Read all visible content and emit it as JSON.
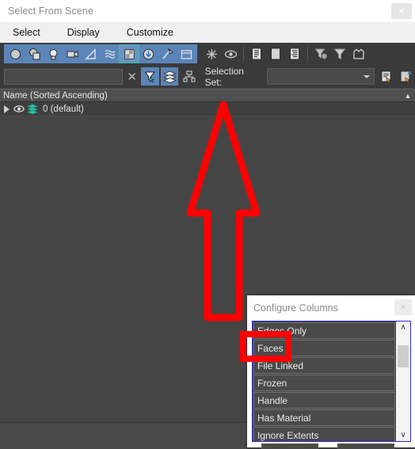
{
  "window": {
    "title": "Select From Scene",
    "close_label": "✕"
  },
  "menubar": {
    "items": [
      {
        "label": "Select"
      },
      {
        "label": "Display"
      },
      {
        "label": "Customize"
      }
    ]
  },
  "toolbar": {
    "filter_group": [
      {
        "icon": "geometry-sphere-icon",
        "selected": false
      },
      {
        "icon": "shapes-icon",
        "selected": false
      },
      {
        "icon": "lights-icon",
        "selected": false
      },
      {
        "icon": "cameras-icon",
        "selected": false
      },
      {
        "icon": "helpers-icon",
        "selected": false
      },
      {
        "icon": "space-warps-icon",
        "selected": false
      },
      {
        "icon": "groups-xrefs-icon",
        "selected": true
      },
      {
        "icon": "external-references-icon",
        "selected": false
      },
      {
        "icon": "bone-objects-icon",
        "selected": false
      },
      {
        "icon": "containers-icon",
        "selected": false
      }
    ],
    "plain_group": [
      {
        "icon": "freeze-snowflake-icon"
      },
      {
        "icon": "display-eye-icon"
      }
    ],
    "doc_group": [
      {
        "icon": "expand-all-icon"
      },
      {
        "icon": "collapse-all-icon"
      },
      {
        "icon": "list-outline-icon"
      }
    ],
    "filter_group2": [
      {
        "icon": "configure-filter-icon"
      },
      {
        "icon": "filter-funnel-icon"
      },
      {
        "icon": "container-box-icon"
      }
    ]
  },
  "search": {
    "value": "",
    "placeholder": "",
    "clear_label": "✕",
    "toggle_find_icon": "find-cursor-icon",
    "toggle_layers_icon": "layers-stack-icon",
    "hierarchy_icon": "hierarchy-icon",
    "selection_set_label": "Selection Set:",
    "selection_set_value": "",
    "save_set_icon": "save-selection-set-icon",
    "new_set_icon": "new-selection-set-icon",
    "overflow_label": "»"
  },
  "tree": {
    "column_header": "Name (Sorted Ascending)",
    "header_corner_icon": "sort-ascending-icon",
    "rows": [
      {
        "label": "0 (default)",
        "expander_icon": "expand-triangle-icon",
        "visibility_icon": "eye-icon",
        "layer_icon": "layers-icon"
      }
    ]
  },
  "configure_columns": {
    "title": "Configure Columns",
    "close_label": "✕",
    "items": [
      {
        "label": "Edges Only",
        "highlighted": false
      },
      {
        "label": "Faces",
        "highlighted": true
      },
      {
        "label": "File Linked",
        "highlighted": false
      },
      {
        "label": "Frozen",
        "highlighted": false
      },
      {
        "label": "Handle",
        "highlighted": false
      },
      {
        "label": "Has Material",
        "highlighted": false
      },
      {
        "label": "Ignore Extents",
        "highlighted": false
      }
    ],
    "scroll_up_label": "∧",
    "scroll_down_label": "∨"
  },
  "annotations": {
    "arrow": {
      "icon": "red-up-arrow-annotation",
      "color": "#fe0000"
    },
    "highlight_box": {
      "icon": "red-highlight-rectangle",
      "color": "#fe0000",
      "targets": "Faces"
    }
  },
  "colors": {
    "window_bg": "#454545",
    "toolbar_bg": "#3a3a3a",
    "accent_blue": "#5b85b8",
    "annotation_red": "#fe0000",
    "layer_teal": "#2fbfa8"
  }
}
